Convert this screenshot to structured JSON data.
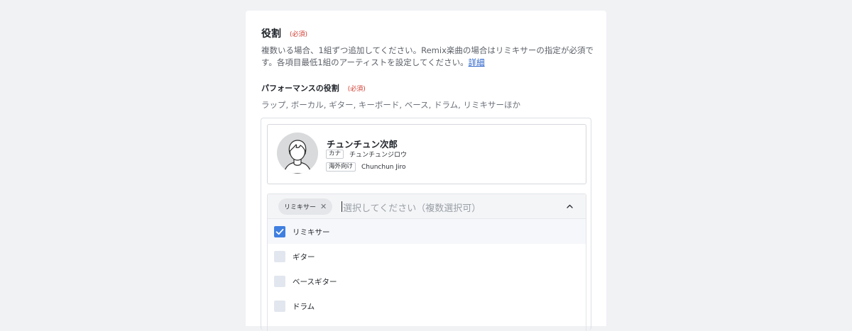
{
  "role_section": {
    "title": "役割",
    "required_label": "(必須)",
    "description": "複数いる場合、1組ずつ追加してください。Remix楽曲の場合はリミキサーの指定が必須です。各項目最低1組のアーティストを設定してください。",
    "details_link": "詳細"
  },
  "performance_role": {
    "title": "パフォーマンスの役割",
    "required_label": "(必須)",
    "hint": "ラップ, ボーカル, ギター, キーボード, ベース, ドラム, リミキサーほか"
  },
  "artist": {
    "name": "チュンチュン次郎",
    "kana_tag": "カナ",
    "kana_value": "チュンチュンジロウ",
    "intl_tag": "海外向け",
    "intl_value": "Chunchun Jiro"
  },
  "role_select": {
    "selected_chip": "リミキサー",
    "chip_remove": "✕",
    "placeholder": "選択してください（複数選択可）",
    "options": [
      {
        "label": "リミキサー",
        "checked": true
      },
      {
        "label": "ギター",
        "checked": false
      },
      {
        "label": "ベースギター",
        "checked": false
      },
      {
        "label": "ドラム",
        "checked": false
      }
    ]
  },
  "colors": {
    "required": "#d23b2f",
    "link": "#2a61c9",
    "checkbox_checked": "#3f7fe0",
    "checkbox_unchecked": "#e2e6ee"
  }
}
